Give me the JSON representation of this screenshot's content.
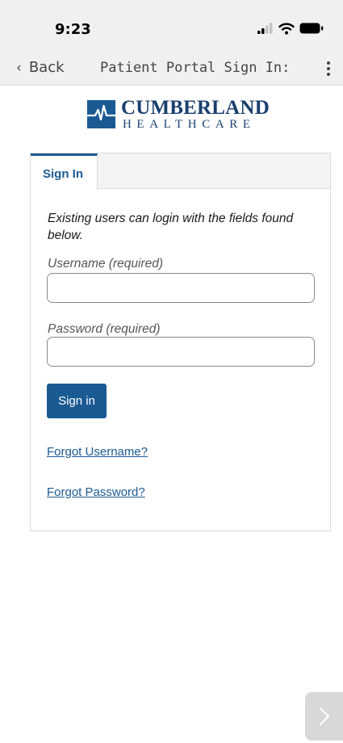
{
  "status_bar": {
    "time": "9:23",
    "icons": [
      "signal-icon",
      "wifi-icon",
      "battery-icon"
    ]
  },
  "nav": {
    "back_label": "Back",
    "back_icon": "chevron-left-icon",
    "title": "Patient Portal Sign In:",
    "menu_icon": "vertical-dots-icon"
  },
  "brand": {
    "name": "CUMBERLAND",
    "subtitle": "HEALTHCARE",
    "color": "#1a3f6e"
  },
  "card": {
    "tabs": [
      {
        "label": "Sign In",
        "active": true
      }
    ],
    "intro_text": "Existing users can login with the fields found below.",
    "username": {
      "label": "Username (required)",
      "value": "",
      "placeholder": ""
    },
    "password": {
      "label": "Password (required)",
      "value": "",
      "placeholder": ""
    },
    "submit_label": "Sign in",
    "forgot_username": "Forgot Username?",
    "forgot_password": "Forgot Password?"
  },
  "floating": {
    "next_icon": "chevron-right-icon"
  },
  "colors": {
    "accent": "#1a5a93",
    "chrome_bg": "#f0f0f0",
    "card_border": "#dcdcdc"
  }
}
